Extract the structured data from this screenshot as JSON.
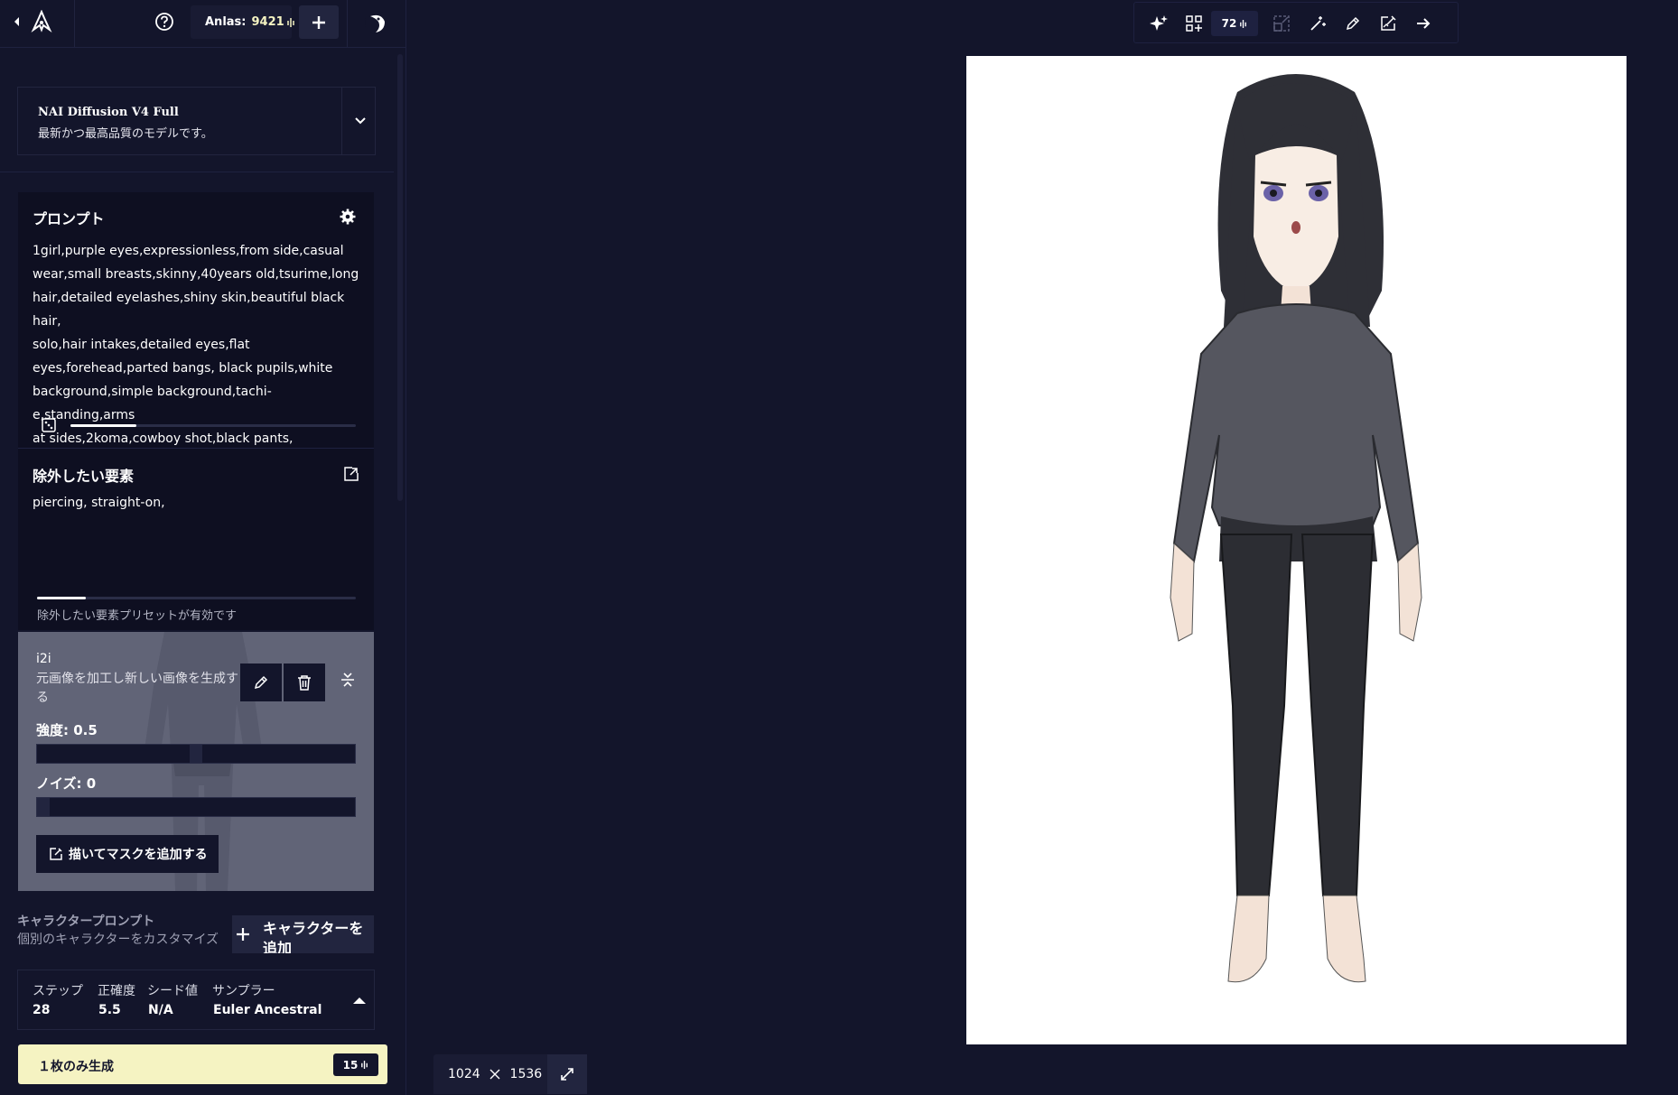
{
  "topbar": {
    "anlas_label": "Anlas:",
    "anlas_value": "9421"
  },
  "model": {
    "name": "NAI Diffusion V4 Full",
    "description": "最新かつ最高品質のモデルです。"
  },
  "prompt": {
    "title": "プロンプト",
    "text": "1girl,purple eyes,expressionless,from side,casual\nwear,small breasts,skinny,40years old,tsurime,long\nhair,detailed eyelashes,shiny skin,beautiful black hair,\nsolo,hair intakes,detailed eyes,flat\neyes,forehead,parted bangs, black pupils,white\nbackground,simple background,tachi-e,standing,arms\nat sides,2koma,cowboy shot,black pants,"
  },
  "negative": {
    "title": "除外したい要素",
    "text": "piercing, straight-on,",
    "note": "除外したい要素プリセットが有効です"
  },
  "i2i": {
    "title": "i2i",
    "description": "元画像を加工し新しい画像を生成する",
    "strength_label": "強度:",
    "strength_value": "0.5",
    "strength_fraction": 0.5,
    "noise_label": "ノイズ:",
    "noise_value": "0",
    "noise_fraction": 0,
    "mask_button": "描いてマスクを追加する"
  },
  "character": {
    "label": "キャラクタープロンプト",
    "sublabel": "個別のキャラクターをカスタマイズ",
    "add_button": "キャラクターを追加"
  },
  "params": {
    "steps_label": "ステップ",
    "steps_value": "28",
    "guidance_label": "正確度",
    "guidance_value": "5.5",
    "seed_label": "シード値",
    "seed_value": "N/A",
    "sampler_label": "サンプラー",
    "sampler_value": "Euler Ancestral"
  },
  "generate": {
    "label": "１枚のみ生成",
    "cost": "15"
  },
  "toolbar": {
    "cost": "72"
  },
  "dimensions": {
    "width": "1024",
    "height": "1536"
  },
  "colors": {
    "background": "#13152b",
    "panel": "#0e0f21",
    "accent": "#f5f3c2",
    "border": "#22253f"
  },
  "icons": [
    "back-arrow-icon",
    "nai-logo-icon",
    "help-icon",
    "plus-icon",
    "avatar-icon",
    "chevron-down-icon",
    "settings-gear-icon",
    "dice-icon",
    "import-icon",
    "pencil-icon",
    "trash-icon",
    "collapse-icon",
    "mask-icon",
    "anlas-icon",
    "sparkle-icon",
    "grid-icon",
    "upscale-icon",
    "magic-wand-icon",
    "paint-icon",
    "edit-image-icon",
    "arrow-right-icon",
    "expand-icon",
    "chevron-up-icon"
  ]
}
